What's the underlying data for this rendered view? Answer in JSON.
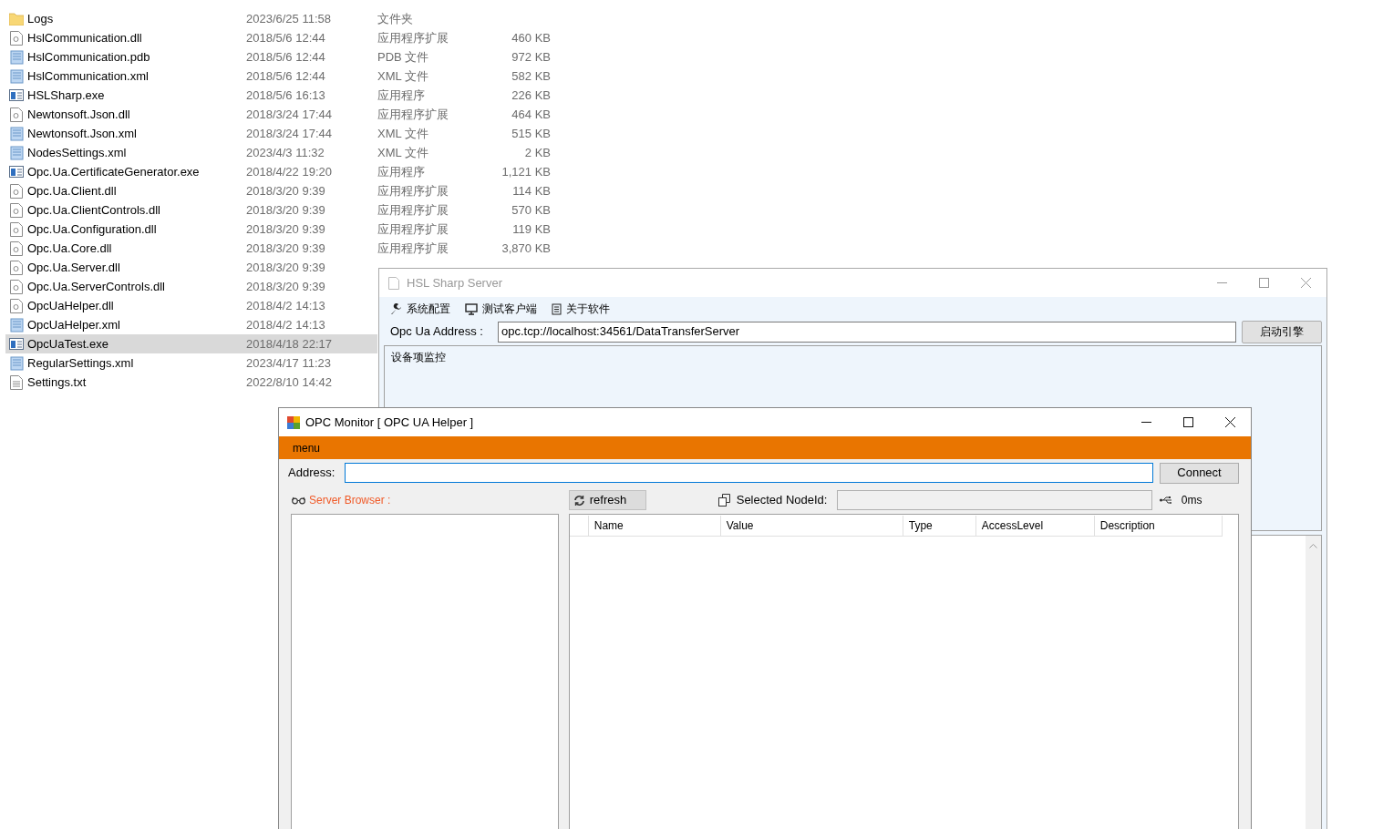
{
  "file_list": {
    "rows": [
      {
        "kind": "folder",
        "name": "Logs",
        "date": "2023/6/25 11:58",
        "type": "文件夹",
        "selected": false
      },
      {
        "kind": "dll",
        "name": "HslCommunication.dll",
        "date": "2018/5/6 12:44",
        "type": "应用程序扩展",
        "size": "460 KB",
        "selected": false
      },
      {
        "kind": "doc",
        "name": "HslCommunication.pdb",
        "date": "2018/5/6 12:44",
        "type": "PDB 文件",
        "size": "972 KB",
        "selected": false
      },
      {
        "kind": "doc",
        "name": "HslCommunication.xml",
        "date": "2018/5/6 12:44",
        "type": "XML 文件",
        "size": "582 KB",
        "selected": false
      },
      {
        "kind": "exe",
        "name": "HSLSharp.exe",
        "date": "2018/5/6 16:13",
        "type": "应用程序",
        "size": "226 KB",
        "selected": false
      },
      {
        "kind": "dll",
        "name": "Newtonsoft.Json.dll",
        "date": "2018/3/24 17:44",
        "type": "应用程序扩展",
        "size": "464 KB",
        "selected": false
      },
      {
        "kind": "doc",
        "name": "Newtonsoft.Json.xml",
        "date": "2018/3/24 17:44",
        "type": "XML 文件",
        "size": "515 KB",
        "selected": false
      },
      {
        "kind": "doc",
        "name": "NodesSettings.xml",
        "date": "2023/4/3 11:32",
        "type": "XML 文件",
        "size": "2 KB",
        "selected": false
      },
      {
        "kind": "exe",
        "name": "Opc.Ua.CertificateGenerator.exe",
        "date": "2018/4/22 19:20",
        "type": "应用程序",
        "size": "1,121 KB",
        "selected": false
      },
      {
        "kind": "dll",
        "name": "Opc.Ua.Client.dll",
        "date": "2018/3/20 9:39",
        "type": "应用程序扩展",
        "size": "114 KB",
        "selected": false
      },
      {
        "kind": "dll",
        "name": "Opc.Ua.ClientControls.dll",
        "date": "2018/3/20 9:39",
        "type": "应用程序扩展",
        "size": "570 KB",
        "selected": false
      },
      {
        "kind": "dll",
        "name": "Opc.Ua.Configuration.dll",
        "date": "2018/3/20 9:39",
        "type": "应用程序扩展",
        "size": "119 KB",
        "selected": false
      },
      {
        "kind": "dll",
        "name": "Opc.Ua.Core.dll",
        "date": "2018/3/20 9:39",
        "type": "应用程序扩展",
        "size": "3,870 KB",
        "selected": false
      },
      {
        "kind": "dll",
        "name": "Opc.Ua.Server.dll",
        "date": "2018/3/20 9:39",
        "selected": false
      },
      {
        "kind": "dll",
        "name": "Opc.Ua.ServerControls.dll",
        "date": "2018/3/20 9:39",
        "selected": false
      },
      {
        "kind": "dll",
        "name": "OpcUaHelper.dll",
        "date": "2018/4/2 14:13",
        "selected": false
      },
      {
        "kind": "doc",
        "name": "OpcUaHelper.xml",
        "date": "2018/4/2 14:13",
        "selected": false
      },
      {
        "kind": "exe",
        "name": "OpcUaTest.exe",
        "date": "2018/4/18 22:17",
        "selected": true
      },
      {
        "kind": "doc",
        "name": "RegularSettings.xml",
        "date": "2023/4/17 11:23",
        "selected": false
      },
      {
        "kind": "txt",
        "name": "Settings.txt",
        "date": "2022/8/10 14:42",
        "selected": false
      }
    ]
  },
  "hsl_window": {
    "title": "HSL Sharp Server",
    "menu": [
      {
        "kind": "wrench",
        "label": "系统配置"
      },
      {
        "kind": "monitor",
        "label": "测试客户端"
      },
      {
        "kind": "document",
        "label": "关于软件"
      }
    ],
    "address_label": "Opc Ua Address :",
    "address_value": "opc.tcp://localhost:34561/DataTransferServer",
    "start_button": "启动引擎",
    "group_title": "设备项监控"
  },
  "opc_window": {
    "title": "OPC Monitor [ OPC UA Helper ]",
    "menu": "menu",
    "address_label": "Address:",
    "connect_button": "Connect",
    "browser_label": "Server Browser :",
    "refresh_button": "refresh",
    "selected_nodeid_label": "Selected NodeId:",
    "latency": "0ms",
    "columns": [
      "Name",
      "Value",
      "Type",
      "AccessLevel",
      "Description"
    ]
  }
}
